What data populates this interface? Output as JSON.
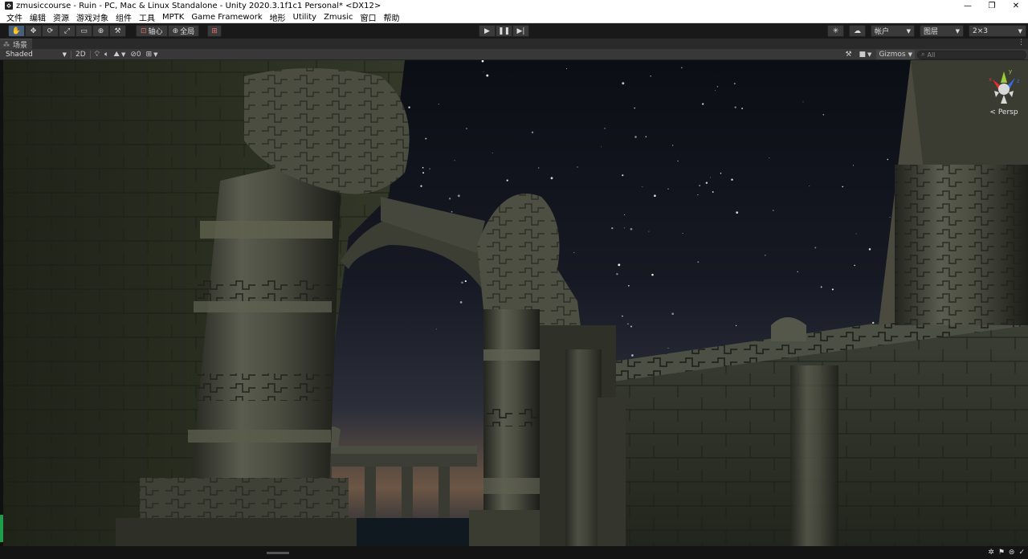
{
  "window": {
    "title": "zmusiccourse - Ruin - PC, Mac & Linux Standalone - Unity 2020.3.1f1c1 Personal* <DX12>",
    "controls": [
      "—",
      "❐",
      "✕"
    ]
  },
  "menu": [
    "文件",
    "编辑",
    "资源",
    "游戏对象",
    "组件",
    "工具",
    "MPTK",
    "Game Framework",
    "地形",
    "Utility",
    "Zmusic",
    "窗口",
    "帮助"
  ],
  "toolbar": {
    "transform_tools": [
      "hand-tool",
      "move-tool",
      "rotate-tool",
      "scale-tool",
      "rect-tool",
      "transform-tool",
      "custom-tool"
    ],
    "pivot_label": "轴心",
    "global_label": "全局",
    "play_controls": [
      "▶",
      "❚❚",
      "▶|"
    ],
    "account_label": "帐户",
    "layers_label": "图层",
    "layout_label": "2×3"
  },
  "scene_tab": {
    "label": "场景"
  },
  "scene_bar": {
    "shading_mode": "Shaded",
    "mode_2d": "2D",
    "hidden_count": "0",
    "gizmos_label": "Gizmos",
    "search_placeholder": "All"
  },
  "gizmo": {
    "projection_label": "< Persp"
  },
  "colors": {
    "sky_top": "#0d0f16",
    "horizon": "#8a6a4a",
    "stone": "#3b3d32",
    "moss": "#2f3527"
  }
}
